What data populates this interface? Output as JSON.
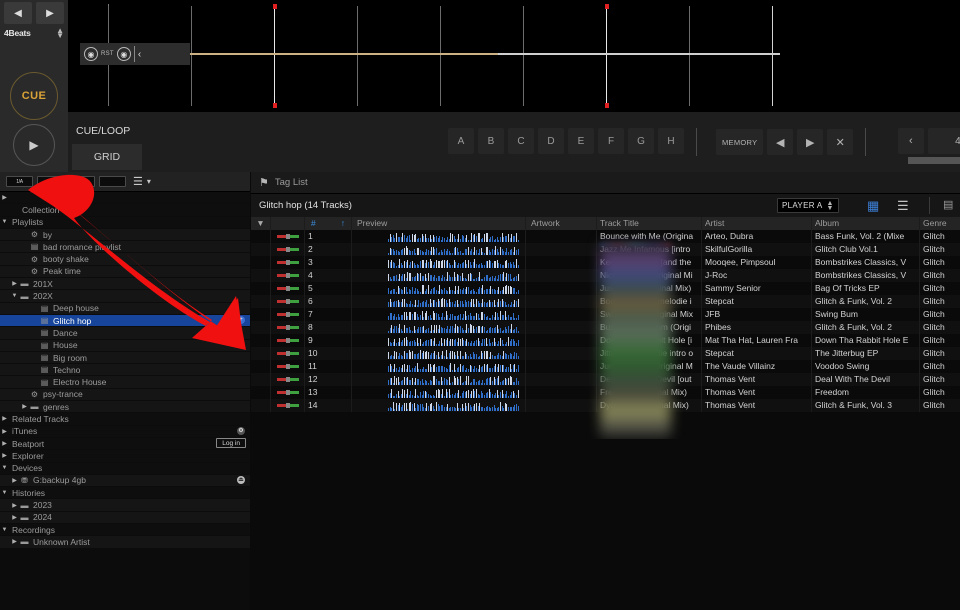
{
  "deck": {
    "nudge_back": "◀",
    "nudge_fwd": "▶",
    "beats_label": "4Beats",
    "cue_label": "CUE",
    "play_label": "▶",
    "tab_cueloop": "CUE/LOOP",
    "tab_grid": "GRID",
    "wave_tools": {
      "loop_in": "◉",
      "rst": "RST",
      "loop_out": "◉",
      "prev": "‹"
    },
    "hotcues": [
      "A",
      "B",
      "C",
      "D",
      "E",
      "F",
      "G",
      "H"
    ],
    "memory_label": "MEMORY",
    "memory_prev": "◀",
    "memory_next": "▶",
    "memory_delete": "✕",
    "zoom_prev": "‹",
    "zoom_value": "4"
  },
  "sidebar": {
    "toolbar": {
      "buttons": [
        "1/A",
        "",
        "",
        ""
      ],
      "list_icon": "☰",
      "chevron": "▾"
    },
    "items": [
      {
        "label": "",
        "indent": 0,
        "tri": "▶",
        "icon": "",
        "style": "dark"
      },
      {
        "label": "Collection",
        "indent": 1,
        "tri": "",
        "icon": "",
        "style": "dark"
      },
      {
        "label": "Playlists",
        "indent": 0,
        "tri": "▼",
        "icon": "",
        "style": "dark"
      },
      {
        "label": "by",
        "indent": 2,
        "tri": "",
        "icon": "⚙",
        "style": "plain"
      },
      {
        "label": "bad romance playlist",
        "indent": 2,
        "tri": "",
        "icon": "▤",
        "style": "plain"
      },
      {
        "label": "booty shake",
        "indent": 2,
        "tri": "",
        "icon": "⚙",
        "style": "plain"
      },
      {
        "label": "Peak time",
        "indent": 2,
        "tri": "",
        "icon": "⚙",
        "style": "plain"
      },
      {
        "label": "201X",
        "indent": 1,
        "tri": "▶",
        "icon": "▬",
        "style": "plain"
      },
      {
        "label": "202X",
        "indent": 1,
        "tri": "▼",
        "icon": "▬",
        "style": "plain"
      },
      {
        "label": "Deep house",
        "indent": 3,
        "tri": "",
        "icon": "▤",
        "style": "plain"
      },
      {
        "label": "Glitch hop",
        "indent": 3,
        "tri": "",
        "icon": "▤",
        "style": "selected",
        "badge": "+"
      },
      {
        "label": "Dance",
        "indent": 3,
        "tri": "",
        "icon": "▤",
        "style": "plain"
      },
      {
        "label": "House",
        "indent": 3,
        "tri": "",
        "icon": "▤",
        "style": "plain"
      },
      {
        "label": "Big room",
        "indent": 3,
        "tri": "",
        "icon": "▤",
        "style": "plain"
      },
      {
        "label": "Techno",
        "indent": 3,
        "tri": "",
        "icon": "▤",
        "style": "plain"
      },
      {
        "label": "Electro House",
        "indent": 3,
        "tri": "",
        "icon": "▤",
        "style": "plain"
      },
      {
        "label": "psy-trance",
        "indent": 2,
        "tri": "",
        "icon": "⚙",
        "style": "plain"
      },
      {
        "label": "genres",
        "indent": 2,
        "tri": "▶",
        "icon": "▬",
        "style": "plain"
      },
      {
        "label": "Related Tracks",
        "indent": 0,
        "tri": "▶",
        "icon": "",
        "style": "dark"
      },
      {
        "label": "iTunes",
        "indent": 0,
        "tri": "▶",
        "icon": "",
        "style": "dark",
        "badge": "⚙",
        "badge_style": "grey"
      },
      {
        "label": "Beatport",
        "indent": 0,
        "tri": "▶",
        "icon": "",
        "style": "dark",
        "login": "Log in"
      },
      {
        "label": "Explorer",
        "indent": 0,
        "tri": "▶",
        "icon": "",
        "style": "dark"
      },
      {
        "label": "Devices",
        "indent": 0,
        "tri": "▼",
        "icon": "",
        "style": "dark"
      },
      {
        "label": "G:backup 4gb",
        "indent": 1,
        "tri": "▶",
        "icon": "⛃",
        "style": "plain",
        "badge": "⏏",
        "badge_style": "dark"
      },
      {
        "label": "Histories",
        "indent": 0,
        "tri": "▼",
        "icon": "",
        "style": "dark"
      },
      {
        "label": "2023",
        "indent": 1,
        "tri": "▶",
        "icon": "▬",
        "style": "plain"
      },
      {
        "label": "2024",
        "indent": 1,
        "tri": "▶",
        "icon": "▬",
        "style": "plain"
      },
      {
        "label": "Recordings",
        "indent": 0,
        "tri": "▼",
        "icon": "",
        "style": "dark"
      },
      {
        "label": "Unknown Artist",
        "indent": 1,
        "tri": "▶",
        "icon": "▬",
        "style": "plain"
      }
    ]
  },
  "main": {
    "tag_list_label": "Tag List",
    "tag_icon": "⚑",
    "list_title": "Glitch hop (14 Tracks)",
    "player_select": "PLAYER A",
    "view_icon_1": "▦",
    "view_icon_2": "☰",
    "view_icon_3": "▤",
    "columns": {
      "filter": "▼",
      "mark": "",
      "num": "#",
      "num_sort": "↑",
      "preview": "Preview",
      "artwork": "Artwork",
      "title": "Track Title",
      "artist": "Artist",
      "album": "Album",
      "genre": "Genre"
    },
    "tracks": [
      {
        "num": "1",
        "title": "Bounce with Me (Origina",
        "artist": "Arteo, Dubra",
        "album": "Bass Funk, Vol. 2 (Mixe",
        "genre": "Glitch"
      },
      {
        "num": "2",
        "title": "Jazz Me Infamous [intro",
        "artist": "SkilfulGorilla",
        "album": "Glitch Club Vol.1",
        "genre": "Glitch"
      },
      {
        "num": "3",
        "title": "Keep Pounding [and the",
        "artist": "Mooqee, Pimpsoul",
        "album": "Bombstrikes Classics, V",
        "genre": "Glitch"
      },
      {
        "num": "4",
        "title": "Nickelodeon (Original Mi",
        "artist": "J-Roc",
        "album": "Bombstrikes Classics, V",
        "genre": "Glitch"
      },
      {
        "num": "5",
        "title": "Just Once (Original Mix)",
        "artist": "Sammy Senior",
        "album": "Bag Of Tricks EP",
        "genre": "Glitch"
      },
      {
        "num": "6",
        "title": "Bootleg Brass [melodie i",
        "artist": "Stepcat",
        "album": "Glitch & Funk, Vol. 2",
        "genre": "Glitch"
      },
      {
        "num": "7",
        "title": "Swing Bum (Original Mix",
        "artist": "JFB",
        "album": "Swing Bum",
        "genre": "Glitch"
      },
      {
        "num": "8",
        "title": "Bust That Rhythm (Origi",
        "artist": "Phibes",
        "album": "Glitch & Funk, Vol. 2",
        "genre": "Glitch"
      },
      {
        "num": "9",
        "title": "Down The Rabbit Hole [i",
        "artist": "Mat Tha Hat, Lauren Fra",
        "album": "Down Tha Rabbit Hole E",
        "genre": "Glitch"
      },
      {
        "num": "10",
        "title": "Jitterbug [melodie intro o",
        "artist": "Stepcat",
        "album": "The Jitterbug EP",
        "genre": "Glitch"
      },
      {
        "num": "11",
        "title": "Jumpin' Jack (Original M",
        "artist": "The Vaude Villainz",
        "album": "Voodoo Swing",
        "genre": "Glitch"
      },
      {
        "num": "12",
        "title": "Deal With The Devil [out",
        "artist": "Thomas Vent",
        "album": "Deal With The Devil",
        "genre": "Glitch"
      },
      {
        "num": "13",
        "title": "Freedom (Original Mix)",
        "artist": "Thomas Vent",
        "album": "Freedom",
        "genre": "Glitch"
      },
      {
        "num": "14",
        "title": "Dynamite (Original Mix)",
        "artist": "Thomas Vent",
        "album": "Glitch & Funk, Vol. 3",
        "genre": "Glitch"
      }
    ]
  },
  "annotation": {
    "color": "#f01010",
    "shape": "arrow-pointing-up-left"
  }
}
